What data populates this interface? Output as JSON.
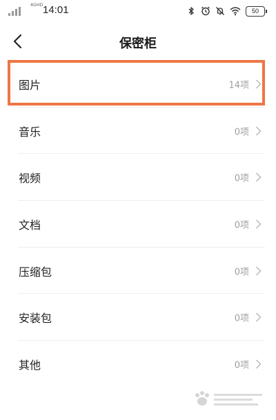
{
  "status_bar": {
    "network": "4GHD",
    "time": "14:01",
    "battery": "50",
    "icons": [
      "bluetooth-icon",
      "alarm-icon",
      "mute-icon",
      "wifi-icon",
      "battery-icon"
    ]
  },
  "header": {
    "title": "保密柜",
    "back_icon": "back-arrow-icon"
  },
  "list": {
    "items": [
      {
        "label": "图片",
        "count": "14项",
        "highlighted": true
      },
      {
        "label": "音乐",
        "count": "0项",
        "highlighted": false
      },
      {
        "label": "视频",
        "count": "0项",
        "highlighted": false
      },
      {
        "label": "文档",
        "count": "0项",
        "highlighted": false
      },
      {
        "label": "压缩包",
        "count": "0项",
        "highlighted": false
      },
      {
        "label": "安装包",
        "count": "0项",
        "highlighted": false
      },
      {
        "label": "其他",
        "count": "0项",
        "highlighted": false
      }
    ]
  },
  "colors": {
    "highlight": "#ee7644",
    "count_text": "#9e9e9e",
    "divider": "#ededed"
  },
  "watermark": {
    "logo": "baidu-jingyan-watermark"
  }
}
